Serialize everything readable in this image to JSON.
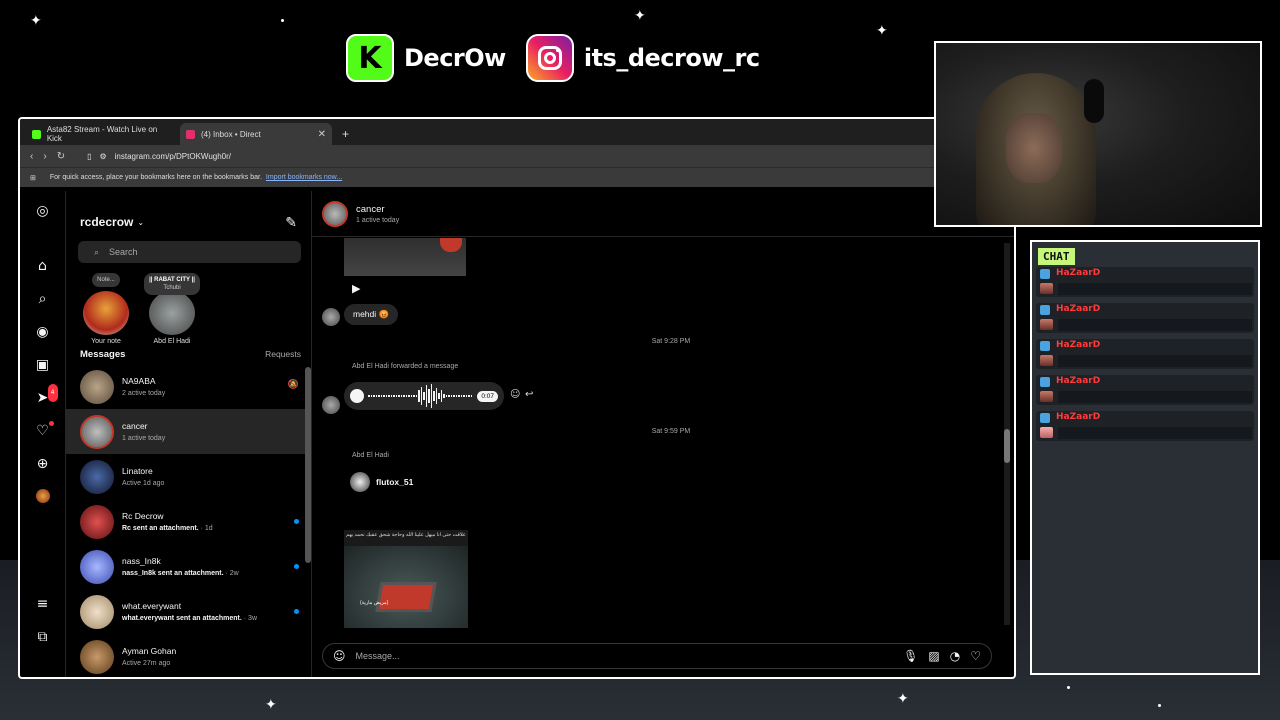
{
  "overlay": {
    "kick_name": "DecrOw",
    "ig_name": "its_decrow_rc",
    "kick_icon": "kick-logo-icon",
    "ig_icon": "instagram-logo-icon"
  },
  "browser": {
    "tabs": [
      {
        "label": "Asta82 Stream - Watch Live on Kick",
        "favicon_color": "#53fc18"
      },
      {
        "label": "(4) Inbox • Direct",
        "favicon_color": "#e1306c"
      }
    ],
    "url": "instagram.com/p/DPtOKWugh0r/",
    "bookmarks_text": "For quick access, place your bookmarks here on the bookmarks bar.",
    "bookmarks_link": "Import bookmarks now..."
  },
  "instagram": {
    "rail_badge": "4",
    "username": "rcdecrow",
    "search_placeholder": "Search",
    "notes": [
      {
        "bubble": "Note...",
        "label": "Your note"
      },
      {
        "bubble_title": "|| RABAT CITY ||",
        "bubble_sub": "Tchubi",
        "label": "Abd El Hadi"
      }
    ],
    "messages_title": "Messages",
    "requests_label": "Requests",
    "conversations": [
      {
        "name": "NA9ABA",
        "sub": "2 active today",
        "muted": true,
        "color": "#7a6a58"
      },
      {
        "name": "cancer",
        "sub": "1 active today",
        "selected": true,
        "color": "#8a8a8a"
      },
      {
        "name": "Linatore",
        "sub": "Active 1d ago",
        "color": "#2b3a5a"
      },
      {
        "name": "Rc Decrow",
        "sub": "Rc sent an attachment.",
        "time": " · 1d",
        "unread": true,
        "color": "#c0392b"
      },
      {
        "name": "nass_In8k",
        "sub": "nass_In8k sent an attachment.",
        "time": " · 2w",
        "unread": true,
        "color": "#6a7ad8"
      },
      {
        "name": "what.everywant",
        "sub": "what.everywant sent an attachment.",
        "time": " · 3w",
        "unread": true,
        "color": "#d8c8b0"
      },
      {
        "name": "Ayman Gohan",
        "sub": "Active 27m ago",
        "color": "#8a6a4a"
      }
    ],
    "chat": {
      "name": "cancer",
      "status": "1 active today",
      "msg_mehdi": "mehdi 😡",
      "time1": "Sat 9:28 PM",
      "forwarded": "Abd El Hadi forwarded a message",
      "voice_duration": "0:07",
      "time2": "Sat 9:59 PM",
      "sender2": "Abd El Hadi",
      "shared_profile": "flutox_51",
      "media_caption": "علاقت حتى انا ميهل علينا الله وحاجة شحق عقبك نحمد بهم",
      "media_subtitle": "(مريض مارية)",
      "composer_placeholder": "Message..."
    }
  },
  "stream_chat": {
    "title": "CHAT",
    "messages": [
      {
        "user": "HaZaarD"
      },
      {
        "user": "HaZaarD"
      },
      {
        "user": "HaZaarD"
      },
      {
        "user": "HaZaarD"
      },
      {
        "user": "HaZaarD"
      }
    ]
  }
}
